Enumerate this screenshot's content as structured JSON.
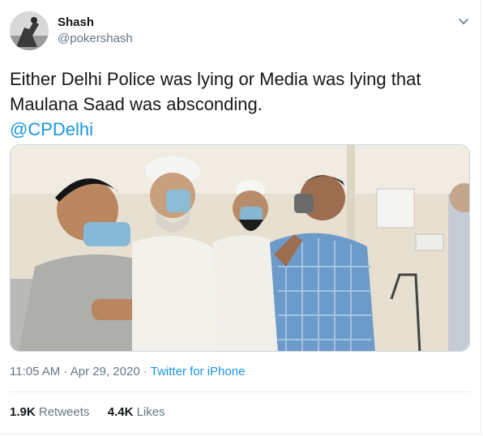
{
  "tweet": {
    "author_name": "Shash",
    "author_handle": "@pokershash",
    "text_line1": "Either Delhi Police was lying or Media was lying that",
    "text_line2": "Maulana Saad was absconding.",
    "mention": "@CPDelhi",
    "time": "11:05 AM",
    "separator": "·",
    "date": "Apr 29, 2020",
    "source": "Twitter for iPhone",
    "retweets_count": "1.9K",
    "retweets_label": "Retweets",
    "likes_count": "4.4K",
    "likes_label": "Likes"
  },
  "colors": {
    "link": "#1b95e0",
    "muted": "#657786",
    "text": "#14171a"
  },
  "icons": {
    "menu": "chevron-down-icon"
  }
}
